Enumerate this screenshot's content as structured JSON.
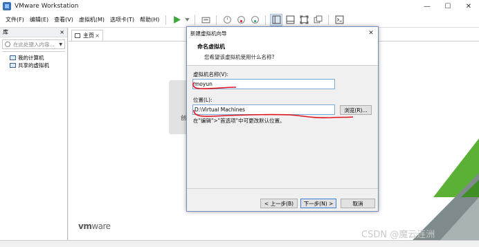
{
  "app": {
    "title": "VMware Workstation",
    "window_controls": [
      "—",
      "☐",
      "✕"
    ]
  },
  "menu": {
    "items": [
      "文件(F)",
      "编辑(E)",
      "查看(V)",
      "虚拟机(M)",
      "选项卡(T)",
      "帮助(H)"
    ]
  },
  "toolbar": {
    "icons": [
      "play-icon",
      "dropdown-icon",
      "send-keys-icon",
      "snapshot-icon",
      "revert-snapshot-icon",
      "snapshot-manager-icon",
      "library-view-icon",
      "thumbnail-bar-icon",
      "fullscreen-icon",
      "unity-icon",
      "console-icon"
    ]
  },
  "library": {
    "header": "库",
    "close": "×",
    "search_placeholder": "在此处键入内容...",
    "tree": [
      "我的计算机",
      "共享的虚拟机"
    ]
  },
  "workspace": {
    "tab_label": "主页",
    "tab_close": "×",
    "card_text": "创",
    "brand_prefix": "vm",
    "brand_suffix": "ware",
    "watermark": "CSDN @魔云连洲"
  },
  "dialog": {
    "title": "新建虚拟机向导",
    "close": "✕",
    "heading": "命名虚拟机",
    "subheading": "您希望该虚拟机使用什么名称?",
    "name_label": "虚拟机名称(V):",
    "name_value": "moyun",
    "location_label": "位置(L):",
    "location_value": "D:\\Virtual Machines",
    "browse_button": "浏览(R)...",
    "hint": "在\"编辑\">\"首选项\"中可更改默认位置。",
    "back_button": "< 上一步(B)",
    "next_button": "下一步(N) >",
    "cancel_button": "取消"
  },
  "colors": {
    "annotation_red": "#e0141e",
    "accent_green": "#5bb135",
    "dialog_border": "#6f8fb8",
    "field_border": "#7aa7d6"
  }
}
